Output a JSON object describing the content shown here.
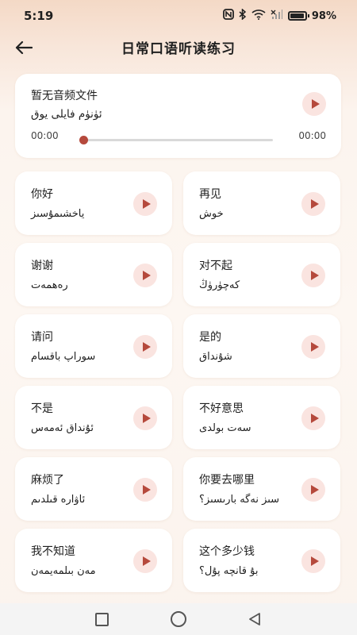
{
  "status": {
    "time": "5:19",
    "battery": "98%"
  },
  "header": {
    "title": "日常口语听读练习"
  },
  "audio": {
    "title_zh": "暂无音频文件",
    "title_ug": "ئۈنۈم فايلى يوق",
    "time_current": "00:00",
    "time_total": "00:00",
    "progress": 0
  },
  "phrases": [
    {
      "zh": "你好",
      "ug": "ياخشىمۇسىز"
    },
    {
      "zh": "再见",
      "ug": "خوش"
    },
    {
      "zh": "谢谢",
      "ug": "رەھمەت"
    },
    {
      "zh": "对不起",
      "ug": "كەچۈرۈڭ"
    },
    {
      "zh": "请问",
      "ug": "سوراپ باقسام"
    },
    {
      "zh": "是的",
      "ug": "شۇنداق"
    },
    {
      "zh": "不是",
      "ug": "ئۇنداق ئەمەس"
    },
    {
      "zh": "不好意思",
      "ug": "سەت بولدى"
    },
    {
      "zh": "麻烦了",
      "ug": "ئاۋارە قىلدىم"
    },
    {
      "zh": "你要去哪里",
      "ug": "سىز نەگە بارىسىز؟"
    },
    {
      "zh": "我不知道",
      "ug": "مەن بىلمەيمەن"
    },
    {
      "zh": "这个多少钱",
      "ug": "بۇ قانچە پۇل؟"
    }
  ],
  "colors": {
    "accent": "#b5493c",
    "play_bg": "#fae4e0"
  }
}
